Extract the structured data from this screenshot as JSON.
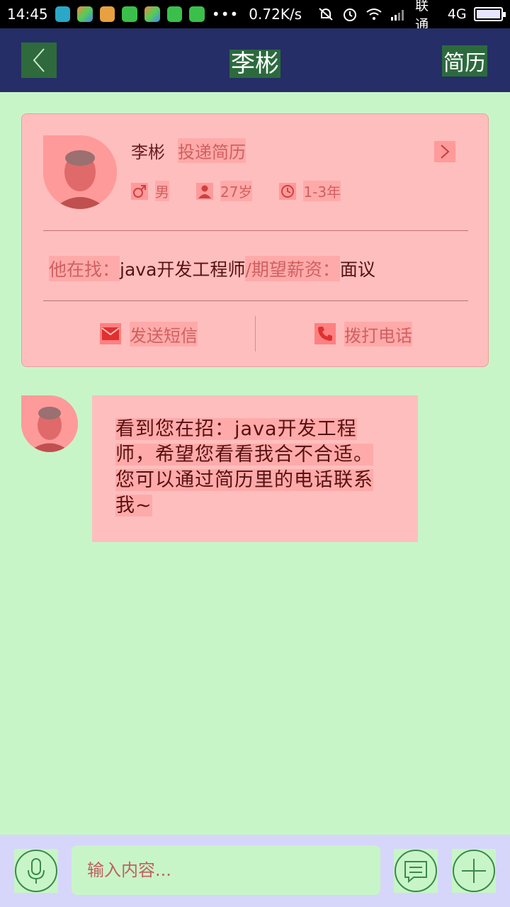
{
  "status_bar": {
    "time": "14:45",
    "overflow": "•••",
    "speed": "0.72K/s",
    "carrier": "联通",
    "network": "4G",
    "battery_level": 0.92
  },
  "header": {
    "back_icon": "chevron-left-icon",
    "title": "李彬",
    "action_label": "简历"
  },
  "card": {
    "name": "李彬",
    "tag": "投递简历",
    "gender": "男",
    "age": "27岁",
    "experience": "1-3年",
    "seeking_label": "他在找：",
    "seeking_value": "java开发工程师",
    "salary_label": "/期望薪资：",
    "salary_value": "面议",
    "sms_label": "发送短信",
    "call_label": "拨打电话"
  },
  "message": {
    "lines": [
      "看到您在招：java开发工程",
      "师，希望您看看我合不合适。",
      "您可以通过简历里的电话联系",
      "我~"
    ]
  },
  "input": {
    "placeholder": "输入内容..."
  },
  "colors": {
    "background": "#c8f5c8",
    "header": "#252e66",
    "card": "#ffbebe",
    "bottom_bar": "#d6d6fa"
  }
}
